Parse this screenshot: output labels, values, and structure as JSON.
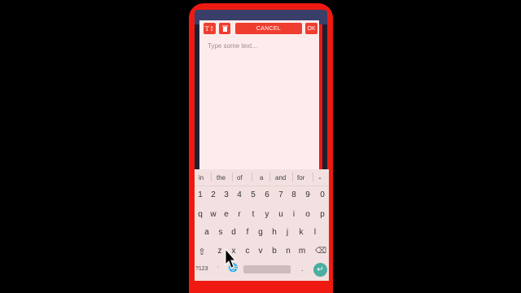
{
  "toolbar": {
    "text_style_label": "T↕",
    "delete_icon": "trash-icon",
    "cancel_label": "CANCEL",
    "ok_label": "OK"
  },
  "editor": {
    "placeholder": "Type some text..."
  },
  "keyboard": {
    "suggestions": [
      "in",
      "the",
      "of",
      "a",
      "and",
      "for"
    ],
    "suggestions_expand_icon": "chevron-down-icon",
    "numbers": [
      "1",
      "2",
      "3",
      "4",
      "5",
      "6",
      "7",
      "8",
      "9",
      "0"
    ],
    "row1": [
      "q",
      "w",
      "e",
      "r",
      "t",
      "y",
      "u",
      "i",
      "o",
      "p"
    ],
    "row2": [
      "a",
      "s",
      "d",
      "f",
      "g",
      "h",
      "j",
      "k",
      "l"
    ],
    "row3": [
      "z",
      "x",
      "c",
      "v",
      "b",
      "n",
      "m"
    ],
    "shift_icon": "shift-icon",
    "backspace_icon": "backspace-icon",
    "symbols_label": "?123",
    "comma_label": ",",
    "globe_icon": "globe-icon",
    "period_label": ".",
    "enter_icon": "enter-icon"
  },
  "colors": {
    "accent": "#ef3e2f",
    "frame": "#ee1a12",
    "dialog_bg": "#fdeceb",
    "enter": "#4aaea0"
  }
}
